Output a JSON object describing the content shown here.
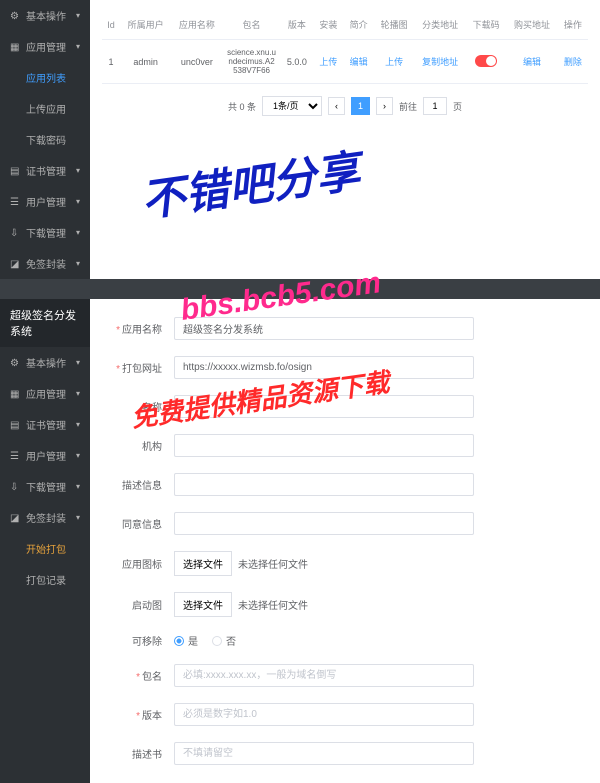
{
  "panel1": {
    "menu": [
      {
        "label": "基本操作",
        "kind": "group"
      },
      {
        "label": "应用管理",
        "kind": "group"
      },
      {
        "label": "应用列表",
        "kind": "item",
        "active": true
      },
      {
        "label": "上传应用",
        "kind": "item"
      },
      {
        "label": "下载密码",
        "kind": "item"
      },
      {
        "label": "证书管理",
        "kind": "group"
      },
      {
        "label": "用户管理",
        "kind": "group"
      },
      {
        "label": "下载管理",
        "kind": "group"
      },
      {
        "label": "免签封装",
        "kind": "group"
      }
    ],
    "table": {
      "headers": [
        "Id",
        "所属用户",
        "应用名称",
        "包名",
        "版本",
        "安装",
        "简介",
        "轮播图",
        "分类地址",
        "下载码",
        "购买地址",
        "操作"
      ],
      "row": {
        "id": "1",
        "user": "admin",
        "name": "unc0ver",
        "pkg": "science.xnu.undecimus.A2538V7F66",
        "ver": "5.0.0",
        "install": "上传",
        "intro": "编辑",
        "carousel": "上传",
        "cat": "复制地址",
        "buy": "编辑",
        "op": "删除"
      }
    },
    "pagination": {
      "total": "共 0 条",
      "size": "1条/页",
      "cur": "1",
      "jump": "前往",
      "page": "1",
      "suffix": "页"
    }
  },
  "panel2": {
    "title": "超级签名分发系统",
    "menu": [
      {
        "label": "基本操作",
        "kind": "group"
      },
      {
        "label": "应用管理",
        "kind": "group"
      },
      {
        "label": "证书管理",
        "kind": "group"
      },
      {
        "label": "用户管理",
        "kind": "group"
      },
      {
        "label": "下载管理",
        "kind": "group"
      },
      {
        "label": "免签封装",
        "kind": "group"
      },
      {
        "label": "开始打包",
        "kind": "item",
        "highlight": true
      },
      {
        "label": "打包记录",
        "kind": "item"
      }
    ],
    "form": {
      "appname_label": "应用名称",
      "appname_value": "超级签名分发系统",
      "url_label": "打包网址",
      "url_value": "https://xxxxx.wizmsb.fo/osign",
      "name_label": "名称",
      "org_label": "机构",
      "desc_label": "描述信息",
      "consent_label": "同意信息",
      "icon_label": "应用图标",
      "file_btn": "选择文件",
      "file_none": "未选择任何文件",
      "splash_label": "启动图",
      "removable_label": "可移除",
      "yes": "是",
      "no": "否",
      "pkg_label": "包名",
      "pkg_placeholder": "必填:xxxx.xxx.xx，一般为域名倒写",
      "ver_label": "版本",
      "ver_placeholder": "必须是数字如1.0",
      "cert_label": "描述书",
      "cert_placeholder": "不填请留空"
    }
  },
  "watermark": {
    "line1": "不错吧分享",
    "line2": "bbs.bcb5.com",
    "line3": "免费提供精品资源下载"
  }
}
